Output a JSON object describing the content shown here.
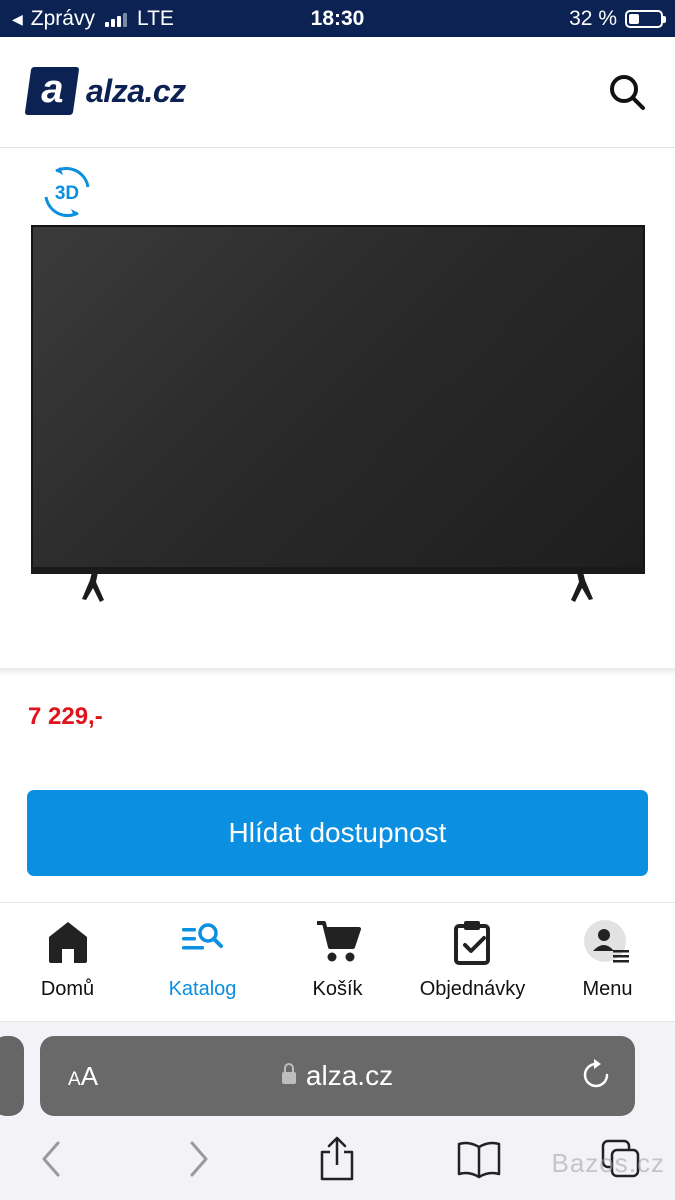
{
  "status_bar": {
    "back_label": "Zprávy",
    "network": "LTE",
    "time": "18:30",
    "battery_text": "32 %",
    "battery_level": 0.32
  },
  "header": {
    "logo_mark": "a",
    "logo_text": "alza.cz",
    "search_icon": "search-icon"
  },
  "product": {
    "badge_3d": "3D",
    "image_icon": "tv-image",
    "price": "7 229,-",
    "watch_button_label": "Hlídat dostupnost"
  },
  "tabbar": {
    "items": [
      {
        "label": "Domů",
        "icon": "home-icon",
        "active": false
      },
      {
        "label": "Katalog",
        "icon": "catalog-search-icon",
        "active": true
      },
      {
        "label": "Košík",
        "icon": "cart-icon",
        "active": false
      },
      {
        "label": "Objednávky",
        "icon": "orders-clipboard-icon",
        "active": false
      },
      {
        "label": "Menu",
        "icon": "user-menu-icon",
        "active": false
      }
    ]
  },
  "safari": {
    "aa_label_small": "A",
    "aa_label_large": "A",
    "url": "alza.cz",
    "watermark": "Bazos.cz"
  },
  "colors": {
    "brand_navy": "#0b2253",
    "accent_blue": "#0b8fe0",
    "price_red": "#e0121b"
  }
}
